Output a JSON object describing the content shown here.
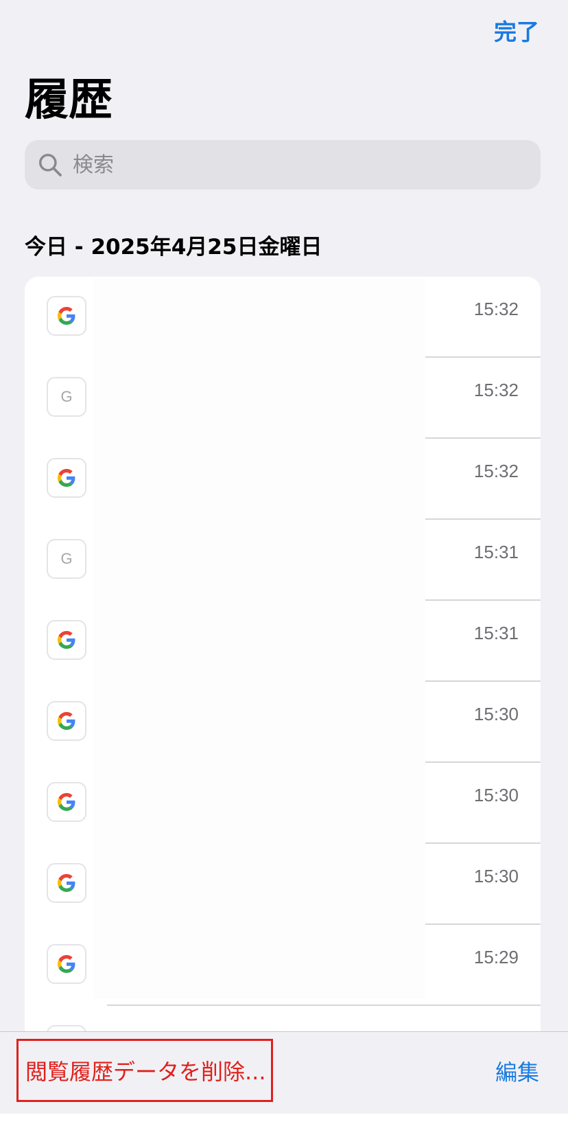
{
  "header": {
    "done_label": "完了",
    "title": "履歴"
  },
  "search": {
    "placeholder": "検索",
    "value": ""
  },
  "section": {
    "title": "今日 - 2025年4月25日金曜日"
  },
  "history": [
    {
      "favicon": "google-color-icon",
      "time": "15:32"
    },
    {
      "favicon": "google-plain-icon",
      "time": "15:32"
    },
    {
      "favicon": "google-color-icon",
      "time": "15:32"
    },
    {
      "favicon": "google-plain-icon",
      "time": "15:31"
    },
    {
      "favicon": "google-color-icon",
      "time": "15:31"
    },
    {
      "favicon": "google-color-icon",
      "time": "15:30"
    },
    {
      "favicon": "google-color-icon",
      "time": "15:30"
    },
    {
      "favicon": "google-color-icon",
      "time": "15:30"
    },
    {
      "favicon": "google-color-icon",
      "time": "15:29"
    }
  ],
  "toolbar": {
    "clear_label": "閲覧履歴データを削除...",
    "edit_label": "編集"
  },
  "colors": {
    "accent": "#1a7ae0",
    "destructive": "#e0201c",
    "background": "#f1f1f5",
    "search_field": "#e2e2e6",
    "separator": "#d6d6da",
    "time_text": "#6d6d72"
  }
}
